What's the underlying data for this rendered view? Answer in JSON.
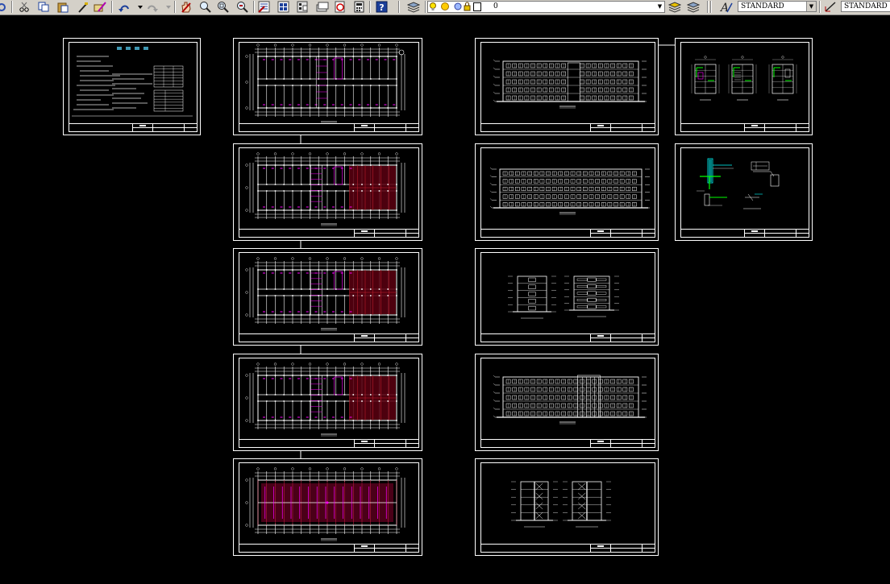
{
  "toolbar": {
    "icons": [
      "undo-icon",
      "cut-icon",
      "copy-icon",
      "paste-icon",
      "match-properties-icon",
      "brush-icon",
      "undo-arrow-icon",
      "redo-arrow-icon",
      "pan-icon",
      "zoom-realtime-icon",
      "zoom-window-icon",
      "zoom-previous-icon",
      "properties-icon",
      "design-center-icon",
      "tool-palettes-icon",
      "sheet-set-icon",
      "markup-icon",
      "calculator-icon",
      "help-icon",
      "layer-manager-icon",
      "layer-state-icon",
      "layer-previous-icon"
    ],
    "layer_name": "0",
    "text_style": "STANDARD",
    "dim_style": "STANDARD",
    "text_style_icon": "text-style-icon",
    "dim_style_icon": "dimension-style-icon",
    "layer_icons": [
      "lightbulb-icon",
      "sun-icon",
      "freeze-icon",
      "lock-icon",
      "color-swatch-icon"
    ]
  },
  "drawing": {
    "background": "#000000",
    "line_color": "#ffffff",
    "accent_magenta": "#ff00ff",
    "accent_red": "#aa0000",
    "accent_cyan": "#00ffff",
    "accent_green": "#00ff00"
  },
  "sheets": [
    {
      "kind": "design-notes"
    },
    {
      "kind": "floor-plan"
    },
    {
      "kind": "floor-plan"
    },
    {
      "kind": "floor-plan"
    },
    {
      "kind": "floor-plan"
    },
    {
      "kind": "roof-plan"
    },
    {
      "kind": "elevation"
    },
    {
      "kind": "elevation"
    },
    {
      "kind": "side-elevations"
    },
    {
      "kind": "elevation"
    },
    {
      "kind": "sections"
    },
    {
      "kind": "details"
    },
    {
      "kind": "wall-details"
    }
  ]
}
